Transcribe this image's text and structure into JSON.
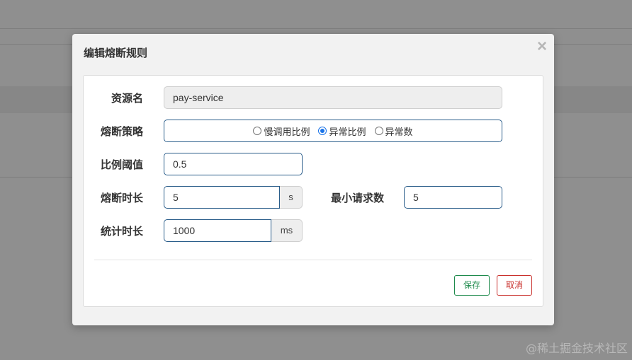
{
  "dialog": {
    "title": "编辑熔断规则",
    "close_glyph": "×"
  },
  "form": {
    "resource": {
      "label": "资源名",
      "value": "pay-service"
    },
    "strategy": {
      "label": "熔断策略",
      "options": [
        {
          "label": "慢调用比例",
          "checked": false
        },
        {
          "label": "异常比例",
          "checked": true
        },
        {
          "label": "异常数",
          "checked": false
        }
      ]
    },
    "ratio_threshold": {
      "label": "比例阈值",
      "value": "0.5"
    },
    "break_duration": {
      "label": "熔断时长",
      "value": "5",
      "unit": "s"
    },
    "min_requests": {
      "label": "最小请求数",
      "value": "5"
    },
    "stat_duration": {
      "label": "统计时长",
      "value": "1000",
      "unit": "ms"
    }
  },
  "buttons": {
    "save": "保存",
    "cancel": "取消"
  },
  "watermark": "@稀土掘金技术社区",
  "colors": {
    "save": "#1e8a4c",
    "cancel": "#c9302c",
    "input_border": "#2a5d8a",
    "radio_checked": "#1a73e8"
  }
}
